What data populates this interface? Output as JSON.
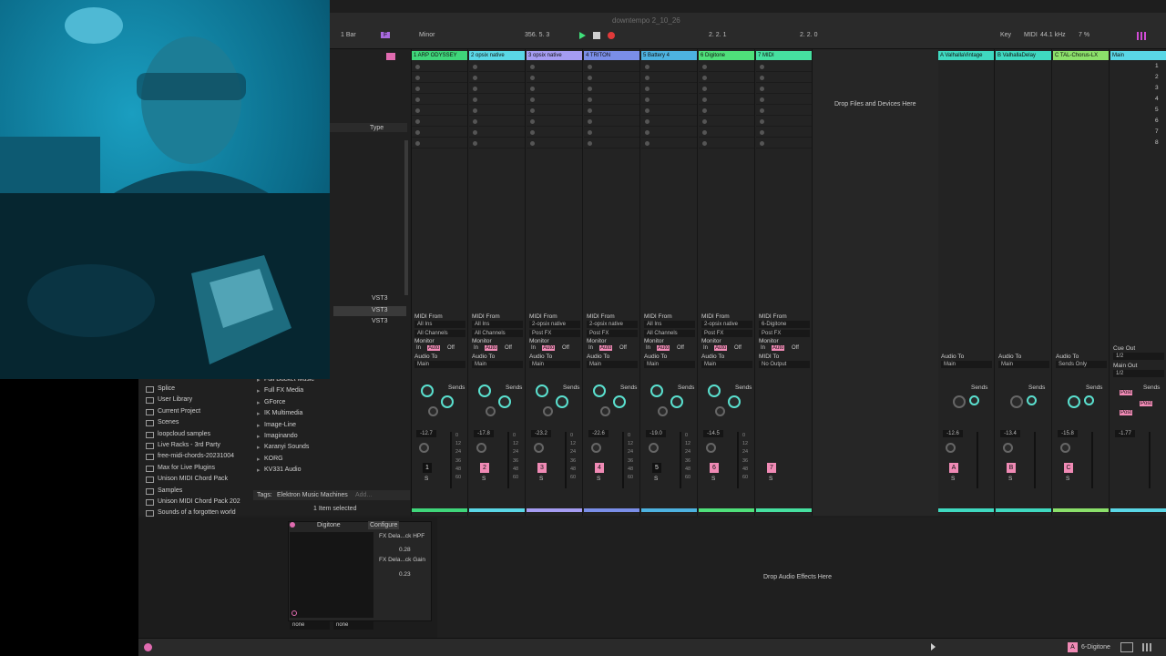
{
  "project_title": "downtempo 2_10_26",
  "transport": {
    "quantize": "1 Bar",
    "key": "F",
    "scale": "Minor",
    "position": "356.  5.  3",
    "loop_start": "2.  2.  1",
    "loop_length": "2.  2.  0",
    "key_label": "Key",
    "midi_label": "MIDI",
    "sample_rate": "44.1 kHz",
    "cpu": "7 %"
  },
  "browser": {
    "column_header": "Type",
    "format_items": [
      "VST3",
      "VST3",
      "VST3"
    ],
    "left_items": [
      "Splice",
      "User Library",
      "Current Project",
      "Scenes",
      "loopcloud samples",
      "Live Racks - 3rd Party",
      "free-midi-chords-20231004",
      "Max for Live Plugins",
      "Unison MIDI Chord Pack",
      "Samples",
      "Unison MIDI Chord Pack  202",
      "Sounds of a forgotten world"
    ],
    "right_items": [
      "Full Bucket Music",
      "Full FX Media",
      "GForce",
      "IK Multimedia",
      "Image-Line",
      "Imaginando",
      "Karanyi Sounds",
      "KORG",
      "KV331 Audio"
    ],
    "tags_label": "Tags:",
    "tags_value": "Elektron Music Machines",
    "tags_add": "Add...",
    "status": "1 Item selected"
  },
  "tracks": [
    {
      "name": "1 ARP ODYSSEY",
      "color": "#3fd67a",
      "midi_from": "All Ins",
      "channel": "All Channels",
      "audio_to": "Main",
      "vol": "-12.7",
      "num": "1"
    },
    {
      "name": "2 opsix native",
      "color": "#5ad7e6",
      "midi_from": "All Ins",
      "channel": "All Channels",
      "audio_to": "Main",
      "vol": "-17.8",
      "num": "2"
    },
    {
      "name": "3 opsix native",
      "color": "#a59cf2",
      "midi_from": "2-opsix native",
      "channel": "Post FX",
      "audio_to": "Main",
      "vol": "-23.2",
      "num": "3"
    },
    {
      "name": "4 TRITON",
      "color": "#7a8ee8",
      "midi_from": "2-opsix native",
      "channel": "Post FX",
      "audio_to": "Main",
      "vol": "-22.6",
      "num": "4"
    },
    {
      "name": "5 Battery 4",
      "color": "#4db2e0",
      "midi_from": "All Ins",
      "channel": "All Channels",
      "audio_to": "Main",
      "vol": "-19.0",
      "num": "5"
    },
    {
      "name": "6 Digitone",
      "color": "#4fe07a",
      "midi_from": "2-opsix native",
      "channel": "Post FX",
      "audio_to": "Main",
      "vol": "-14.5",
      "num": "6"
    },
    {
      "name": "7 MIDI",
      "color": "#46e0a0",
      "midi_from": "6-Digitone",
      "channel": "Post FX",
      "audio_to": "No Output",
      "vol": "",
      "num": "7"
    }
  ],
  "returns": [
    {
      "name": "A ValhallaVintage",
      "color": "#3fd9c0",
      "audio_to": "Main",
      "vol": "-12.6",
      "num": "A"
    },
    {
      "name": "B ValhallaDelay",
      "color": "#3fd9c0",
      "audio_to": "Main",
      "vol": "-13.4",
      "num": "B"
    },
    {
      "name": "C TAL-Chorus-LX",
      "color": "#8be06a",
      "audio_to": "Sends Only",
      "vol": "-15.8",
      "num": "C"
    },
    {
      "name": "Main",
      "color": "#5ad7e6",
      "cue_out": "1/2",
      "main_out": "1/2",
      "vol": "-1.77"
    }
  ],
  "labels": {
    "midi_from": "MIDI From",
    "monitor": "Monitor",
    "in": "In",
    "auto": "Auto",
    "off": "Off",
    "audio_to": "Audio To",
    "midi_to": "MIDI To",
    "sends": "Sends",
    "cue_out": "Cue Out",
    "main_out": "Main Out",
    "drop_files": "Drop Files and Devices Here",
    "drop_audio": "Drop Audio Effects Here",
    "post": "Post",
    "solo": "S"
  },
  "scenes": [
    "1",
    "2",
    "3",
    "4",
    "5",
    "6",
    "7",
    "8"
  ],
  "meter_scale": [
    "0",
    "12",
    "24",
    "36",
    "48",
    "60"
  ],
  "device": {
    "name": "Digitone",
    "configure": "Configure",
    "param1": "FX Dela...ck HPF",
    "param1_val": "0.28",
    "param2": "FX Dela...ck Gain",
    "param2_val": "0.23",
    "preset1": "none",
    "preset2": "none"
  },
  "status_bar": {
    "track_letter": "A",
    "selected_track": "6-Digitone"
  }
}
